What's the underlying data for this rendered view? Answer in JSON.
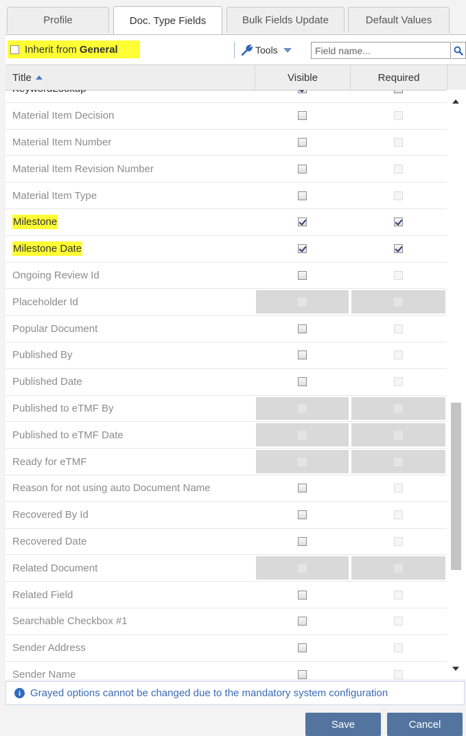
{
  "tabs": [
    {
      "label": "Profile",
      "active": false
    },
    {
      "label": "Doc. Type Fields",
      "active": true
    },
    {
      "label": "Bulk Fields Update",
      "active": false
    },
    {
      "label": "Default Values",
      "active": false
    }
  ],
  "toolbar": {
    "inherit_label": "Inherit from",
    "inherit_source": "General",
    "tools_label": "Tools",
    "search_placeholder": "Field name..."
  },
  "grid": {
    "columns": {
      "title": "Title",
      "visible": "Visible",
      "required": "Required"
    },
    "rows": [
      {
        "title": "KeywordLookup",
        "visible": "checked",
        "required": "unchecked",
        "shaded": false,
        "black": true,
        "highlight": false
      },
      {
        "title": "Material Item Decision",
        "visible": "unchecked",
        "required": "disabled",
        "shaded": false,
        "black": false,
        "highlight": false
      },
      {
        "title": "Material Item Number",
        "visible": "unchecked",
        "required": "disabled",
        "shaded": false,
        "black": false,
        "highlight": false
      },
      {
        "title": "Material Item Revision Number",
        "visible": "unchecked",
        "required": "disabled",
        "shaded": false,
        "black": false,
        "highlight": false
      },
      {
        "title": "Material Item Type",
        "visible": "unchecked",
        "required": "disabled",
        "shaded": false,
        "black": false,
        "highlight": false
      },
      {
        "title": "Milestone",
        "visible": "checked",
        "required": "checked",
        "shaded": false,
        "black": true,
        "highlight": true
      },
      {
        "title": "Milestone Date",
        "visible": "checked",
        "required": "checked",
        "shaded": false,
        "black": true,
        "highlight": true
      },
      {
        "title": "Ongoing Review Id",
        "visible": "unchecked",
        "required": "disabled",
        "shaded": false,
        "black": false,
        "highlight": false
      },
      {
        "title": "Placeholder Id",
        "visible": "ghost",
        "required": "ghost",
        "shaded": true,
        "black": false,
        "highlight": false
      },
      {
        "title": "Popular Document",
        "visible": "unchecked",
        "required": "disabled",
        "shaded": false,
        "black": false,
        "highlight": false
      },
      {
        "title": "Published By",
        "visible": "unchecked",
        "required": "disabled",
        "shaded": false,
        "black": false,
        "highlight": false
      },
      {
        "title": "Published Date",
        "visible": "unchecked",
        "required": "disabled",
        "shaded": false,
        "black": false,
        "highlight": false
      },
      {
        "title": "Published to eTMF By",
        "visible": "ghost",
        "required": "ghost",
        "shaded": true,
        "black": false,
        "highlight": false
      },
      {
        "title": "Published to eTMF Date",
        "visible": "ghost",
        "required": "ghost",
        "shaded": true,
        "black": false,
        "highlight": false
      },
      {
        "title": "Ready for eTMF",
        "visible": "ghost",
        "required": "ghost",
        "shaded": true,
        "black": false,
        "highlight": false
      },
      {
        "title": "Reason for not using auto Document Name",
        "visible": "unchecked",
        "required": "disabled",
        "shaded": false,
        "black": false,
        "highlight": false
      },
      {
        "title": "Recovered By Id",
        "visible": "unchecked",
        "required": "disabled",
        "shaded": false,
        "black": false,
        "highlight": false
      },
      {
        "title": "Recovered Date",
        "visible": "unchecked",
        "required": "disabled",
        "shaded": false,
        "black": false,
        "highlight": false
      },
      {
        "title": "Related Document",
        "visible": "ghost",
        "required": "ghost",
        "shaded": true,
        "black": false,
        "highlight": false
      },
      {
        "title": "Related Field",
        "visible": "unchecked",
        "required": "disabled",
        "shaded": false,
        "black": false,
        "highlight": false
      },
      {
        "title": "Searchable Checkbox #1",
        "visible": "unchecked",
        "required": "disabled",
        "shaded": false,
        "black": false,
        "highlight": false
      },
      {
        "title": "Sender Address",
        "visible": "unchecked",
        "required": "disabled",
        "shaded": false,
        "black": false,
        "highlight": false
      },
      {
        "title": "Sender Name",
        "visible": "unchecked",
        "required": "disabled",
        "shaded": false,
        "black": false,
        "highlight": false
      }
    ]
  },
  "info": {
    "icon": "info-icon",
    "text": "Grayed options cannot be changed due to the mandatory system configuration"
  },
  "buttons": {
    "save": "Save",
    "cancel": "Cancel"
  },
  "colors": {
    "highlight": "#ffff33",
    "accent": "#52749f",
    "info_text": "#3a6cb5"
  }
}
